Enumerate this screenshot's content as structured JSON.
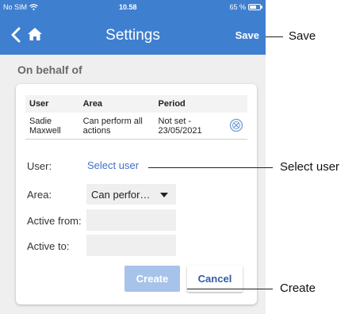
{
  "status_bar": {
    "carrier": "No SIM",
    "time": "10.58",
    "battery": "65 %",
    "battery_level": 0.65
  },
  "nav": {
    "title": "Settings",
    "save_label": "Save"
  },
  "section": {
    "title": "On behalf of"
  },
  "table": {
    "headers": [
      "User",
      "Area",
      "Period"
    ],
    "rows": [
      {
        "user": "Sadie Maxwell",
        "area": "Can perform all actions",
        "period": "Not set - 23/05/2021"
      }
    ]
  },
  "form": {
    "user_label": "User:",
    "user_value": "Select user",
    "area_label": "Area:",
    "area_value": "Can perfor…",
    "active_from_label": "Active from:",
    "active_to_label": "Active to:",
    "active_from_value": "",
    "active_to_value": ""
  },
  "buttons": {
    "create": "Create",
    "cancel": "Cancel"
  },
  "annotations": {
    "save": "Save",
    "select_user": "Select user",
    "create": "Create"
  },
  "colors": {
    "header_blue": "#3f7fcf",
    "create_disabled": "#a7c3ea",
    "link_blue": "#3f6fc8"
  }
}
